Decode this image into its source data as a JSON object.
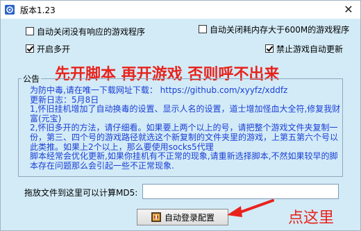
{
  "window": {
    "title": "版本1.23",
    "close_symbol": "✕"
  },
  "options": {
    "auto_close_unresponsive": {
      "label": "自动关闭没有响应的游戏程序",
      "checked": false
    },
    "auto_close_memory": {
      "label": "自动关闭耗内存大于600M的游戏程序",
      "checked": false
    },
    "multi_open": {
      "label": "开启多开",
      "checked": true
    },
    "disable_auto_update": {
      "label": "禁止游戏自动更新",
      "checked": true
    }
  },
  "banner": "先开脚本 再开游戏 否则呼不出来",
  "notice": {
    "title": "公告",
    "lines": [
      "为防中毒,请在唯一下载网址下载：  https://github.com/xyyfz/xddfz",
      "更新日志：5月8日",
      "1,怀旧挂机增加了自动换毒的设置、显示人名的设置，道士增加怪血大全符,修复我财富(元宝)",
      "2,怀旧多开的方法，请仔细看。如果要上两个以上的号，请把整个游戏文件夹复制一份，第三、四个号的游戏路径就选这个新复制的文件夹里的游戏，上第五第六个号以此类推。如果上2个以上，那么要使用socks5代理",
      "脚本经常会优化更新,如果你挂机有不正常的现象,请重新选择脚本,不然如果较早的脚本存在问题那么会引起一些不正常现象."
    ]
  },
  "md5": {
    "label": "拖放文件到这里可以计算MD5:",
    "value": ""
  },
  "login_button": {
    "label": "自动登录配置"
  },
  "annotation": {
    "text": "点这里",
    "color": "#e8231c"
  },
  "icons": {
    "app": "settings-app-icon",
    "login_button": "lock-gear-icon",
    "arrow": "red-arrow-icon"
  }
}
